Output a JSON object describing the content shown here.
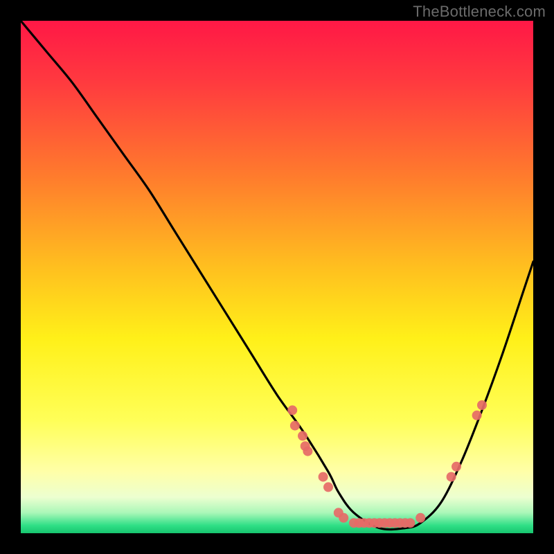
{
  "watermark": "TheBottleneck.com",
  "chart_data": {
    "type": "line",
    "title": "",
    "xlabel": "",
    "ylabel": "",
    "xlim": [
      0,
      100
    ],
    "ylim": [
      0,
      100
    ],
    "series": [
      {
        "name": "curve",
        "x": [
          0,
          5,
          10,
          15,
          20,
          25,
          30,
          35,
          40,
          45,
          50,
          55,
          60,
          62,
          65,
          70,
          75,
          78,
          82,
          86,
          90,
          94,
          98,
          100
        ],
        "y": [
          100,
          94,
          88,
          81,
          74,
          67,
          59,
          51,
          43,
          35,
          27,
          20,
          12,
          8,
          4,
          1,
          1,
          2,
          6,
          14,
          24,
          35,
          47,
          53
        ]
      }
    ],
    "scatter": [
      {
        "x": 53,
        "y": 24
      },
      {
        "x": 53.5,
        "y": 21
      },
      {
        "x": 55,
        "y": 19
      },
      {
        "x": 55.5,
        "y": 17
      },
      {
        "x": 56,
        "y": 16
      },
      {
        "x": 59,
        "y": 11
      },
      {
        "x": 60,
        "y": 9
      },
      {
        "x": 62,
        "y": 4
      },
      {
        "x": 63,
        "y": 3
      },
      {
        "x": 65,
        "y": 2
      },
      {
        "x": 66,
        "y": 2
      },
      {
        "x": 67,
        "y": 2
      },
      {
        "x": 68,
        "y": 2
      },
      {
        "x": 69,
        "y": 2
      },
      {
        "x": 70,
        "y": 2
      },
      {
        "x": 71,
        "y": 2
      },
      {
        "x": 72,
        "y": 2
      },
      {
        "x": 73,
        "y": 2
      },
      {
        "x": 74,
        "y": 2
      },
      {
        "x": 75,
        "y": 2
      },
      {
        "x": 76,
        "y": 2
      },
      {
        "x": 78,
        "y": 3
      },
      {
        "x": 84,
        "y": 11
      },
      {
        "x": 85,
        "y": 13
      },
      {
        "x": 89,
        "y": 23
      },
      {
        "x": 90,
        "y": 25
      }
    ],
    "gradient_stops": [
      {
        "offset": 0.0,
        "color": "#ff1846"
      },
      {
        "offset": 0.12,
        "color": "#ff3a3f"
      },
      {
        "offset": 0.3,
        "color": "#ff7a2d"
      },
      {
        "offset": 0.48,
        "color": "#ffbf1f"
      },
      {
        "offset": 0.62,
        "color": "#fff019"
      },
      {
        "offset": 0.78,
        "color": "#ffff58"
      },
      {
        "offset": 0.88,
        "color": "#ffffa8"
      },
      {
        "offset": 0.93,
        "color": "#ecffd0"
      },
      {
        "offset": 0.96,
        "color": "#aaf7b8"
      },
      {
        "offset": 0.985,
        "color": "#2fdf86"
      },
      {
        "offset": 1.0,
        "color": "#17c56e"
      }
    ]
  }
}
